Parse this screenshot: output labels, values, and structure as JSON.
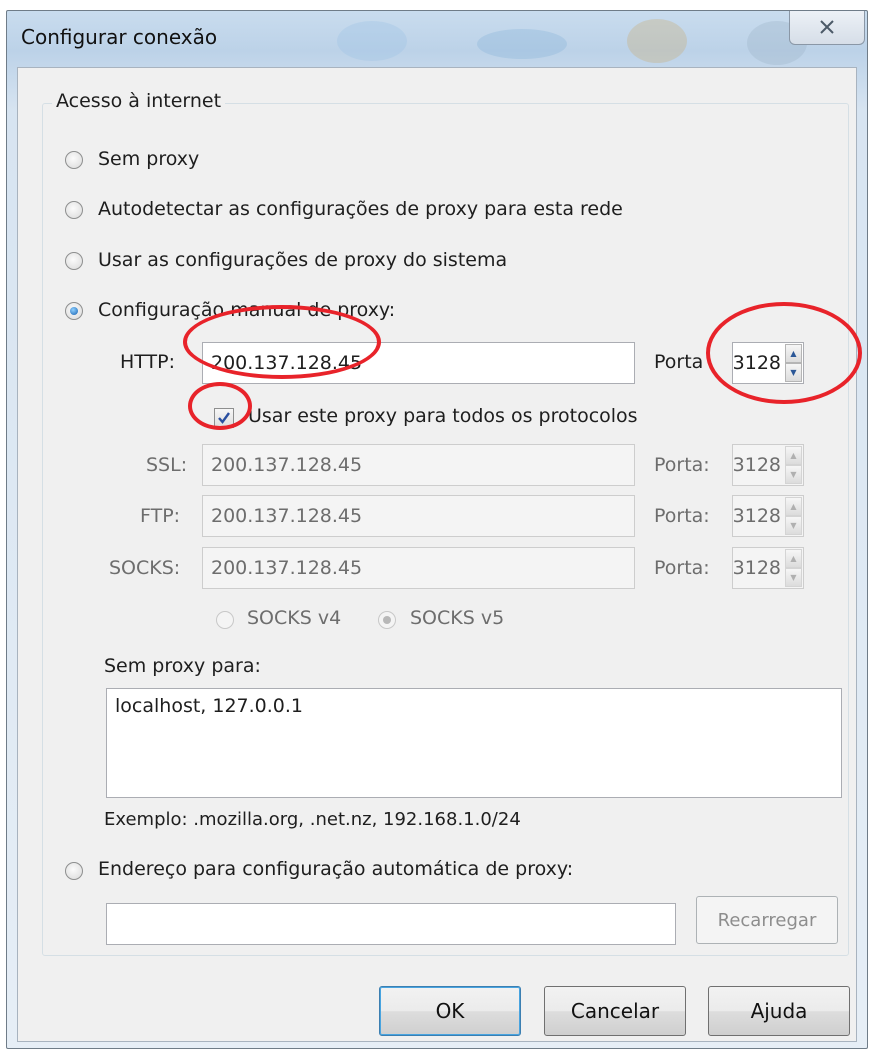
{
  "window": {
    "title": "Configurar conexão"
  },
  "group": {
    "legend": "Acesso à internet"
  },
  "options": {
    "no_proxy": "Sem proxy",
    "autodetect": "Autodetectar as configurações de proxy para esta rede",
    "system": "Usar as configurações de proxy do sistema",
    "manual": "Configuração manual de proxy:",
    "selected": "manual"
  },
  "http": {
    "label": "HTTP:",
    "host": "200.137.128.45",
    "port_label": "Porta",
    "port": "3128"
  },
  "use_for_all": {
    "label": "Usar este proxy para todos os protocolos",
    "checked": true
  },
  "ssl": {
    "label": "SSL:",
    "host": "200.137.128.45",
    "port_label": "Porta:",
    "port": "3128"
  },
  "ftp": {
    "label": "FTP:",
    "host": "200.137.128.45",
    "port_label": "Porta:",
    "port": "3128"
  },
  "socks": {
    "label": "SOCKS:",
    "host": "200.137.128.45",
    "port_label": "Porta:",
    "port": "3128",
    "v4": "SOCKS v4",
    "v5": "SOCKS v5",
    "selected_version": "v5"
  },
  "no_proxy_for": {
    "label": "Sem proxy para:",
    "value": "localhost, 127.0.0.1",
    "example": "Exemplo: .mozilla.org, .net.nz, 192.168.1.0/24"
  },
  "auto_config": {
    "label": "Endereço para configuração automática de proxy:",
    "url": "",
    "reload_label": "Recarregar"
  },
  "buttons": {
    "ok": "OK",
    "cancel": "Cancelar",
    "help": "Ajuda"
  },
  "colors": {
    "annotation": "#e8232a",
    "accent": "#3c7fb1"
  }
}
